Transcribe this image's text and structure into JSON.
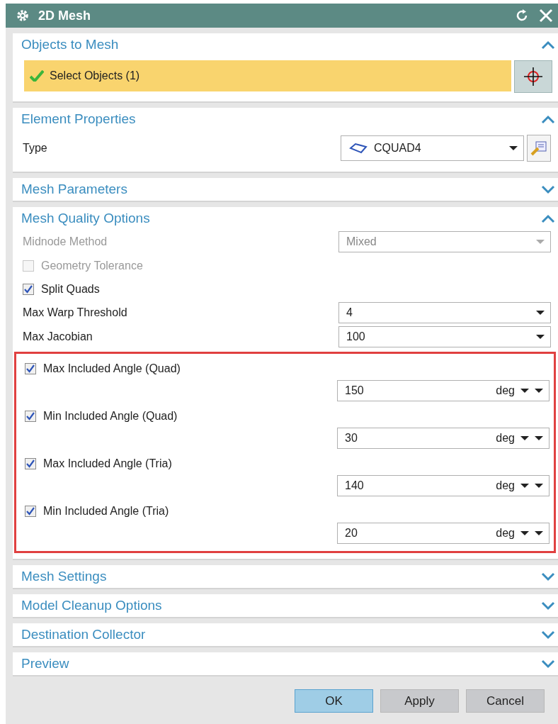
{
  "window": {
    "title": "2D Mesh"
  },
  "sections": [
    {
      "title": "Objects to Mesh",
      "expanded": true,
      "rows": [
        {
          "kind": "selection",
          "label": "Select Objects (1)",
          "done": true
        }
      ]
    },
    {
      "title": "Element Properties",
      "expanded": true,
      "rows": [
        {
          "kind": "type",
          "label": "Type",
          "value": "CQUAD4"
        }
      ]
    },
    {
      "title": "Mesh Parameters",
      "expanded": false
    },
    {
      "title": "Mesh Quality Options",
      "expanded": true,
      "rows": [
        {
          "kind": "dropdown",
          "label": "Midnode Method",
          "value": "Mixed",
          "disabled": true
        },
        {
          "kind": "checkbox",
          "label": "Geometry Tolerance",
          "checked": false,
          "disabled": true
        },
        {
          "kind": "checkbox",
          "label": "Split Quads",
          "checked": true,
          "disabled": false
        },
        {
          "kind": "dropdown",
          "label": "Max Warp Threshold",
          "value": "4",
          "disabled": false
        },
        {
          "kind": "dropdown",
          "label": "Max Jacobian",
          "value": "100",
          "disabled": false
        },
        {
          "kind": "group",
          "highlighted": true,
          "children": [
            {
              "kind": "angle",
              "label": "Max Included Angle (Quad)",
              "checked": true,
              "value": "150",
              "unit": "deg"
            },
            {
              "kind": "angle",
              "label": "Min Included Angle (Quad)",
              "checked": true,
              "value": "30",
              "unit": "deg"
            },
            {
              "kind": "angle",
              "label": "Max Included Angle (Tria)",
              "checked": true,
              "value": "140",
              "unit": "deg"
            },
            {
              "kind": "angle",
              "label": "Min Included Angle (Tria)",
              "checked": true,
              "value": "20",
              "unit": "deg"
            }
          ]
        }
      ]
    },
    {
      "title": "Mesh Settings",
      "expanded": false
    },
    {
      "title": "Model Cleanup Options",
      "expanded": false
    },
    {
      "title": "Destination Collector",
      "expanded": false
    },
    {
      "title": "Preview",
      "expanded": false
    }
  ],
  "buttons": [
    {
      "label": "OK",
      "primary": true
    },
    {
      "label": "Apply",
      "primary": false
    },
    {
      "label": "Cancel",
      "primary": false
    }
  ]
}
